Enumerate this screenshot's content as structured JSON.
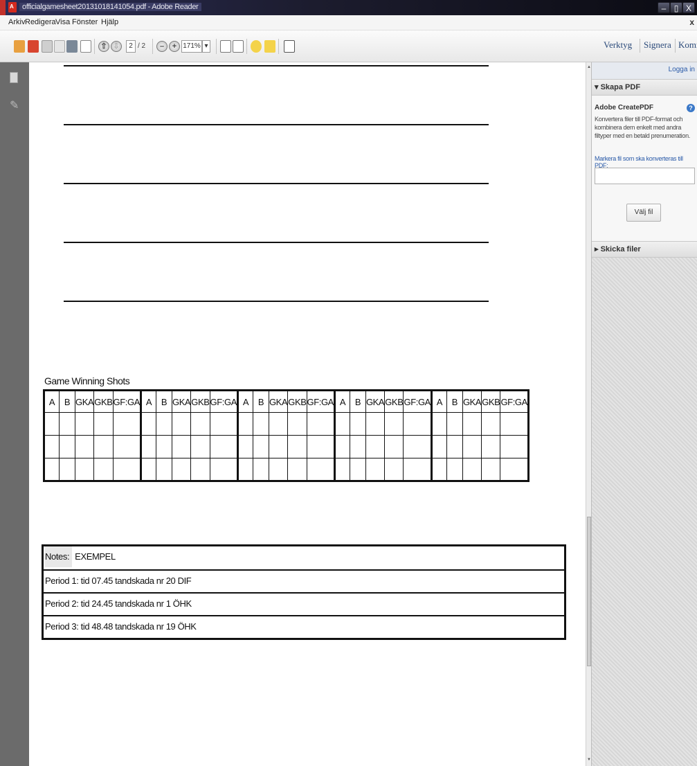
{
  "window": {
    "title": "officialgamesheet20131018141054.pdf - Adobe Reader",
    "minimize": "–",
    "maximize": "▯",
    "close": "X"
  },
  "menu": {
    "items": [
      "Arkiv",
      "Redigera",
      "Visa",
      "Fönster",
      "Hjälp"
    ],
    "close": "x"
  },
  "toolbar": {
    "page_current": "2",
    "page_total": "/ 2",
    "zoom": "171%",
    "zoom_arrow": "▾",
    "links": [
      "Verktyg",
      "Signera",
      "Kommentar"
    ]
  },
  "document": {
    "game_winning_shots_title": "Game Winning Shots",
    "table_headers": [
      "A",
      "B",
      "GKA",
      "GKB",
      "GF:GA",
      "A",
      "B",
      "GKA",
      "GKB",
      "GF:GA",
      "A",
      "B",
      "GKA",
      "GKB",
      "GF:GA",
      "A",
      "B",
      "GKA",
      "GKB",
      "GF:GA",
      "A",
      "B",
      "GKA",
      "GKB",
      "GF:GA"
    ],
    "notes_label": "Notes:",
    "notes_value": "EXEMPEL",
    "period_notes": [
      "Period 1: tid 07.45 tandskada nr 20 DIF",
      "Period 2: tid 24.45 tandskada nr 1 ÖHK",
      "Period 3: tid 48.48 tandskada nr 19 ÖHK"
    ]
  },
  "right_pane": {
    "login": "Logga in",
    "section_create": "▾  Skapa PDF",
    "create_title": "Adobe CreatePDF",
    "help": "?",
    "description": "Konvertera filer till PDF-format och kombinera dem enkelt med andra filtyper med en betald prenumeration.",
    "mark_label": "Markera fil som ska konverteras till PDF:",
    "choose_file_button": "Välj fil",
    "section_send": "▸  Skicka filer"
  },
  "colors": {
    "titlebar": "#1c1c2e",
    "left_panel": "#6b6b6b",
    "link_blue": "#2a5aa8",
    "table_border": "#111111"
  }
}
